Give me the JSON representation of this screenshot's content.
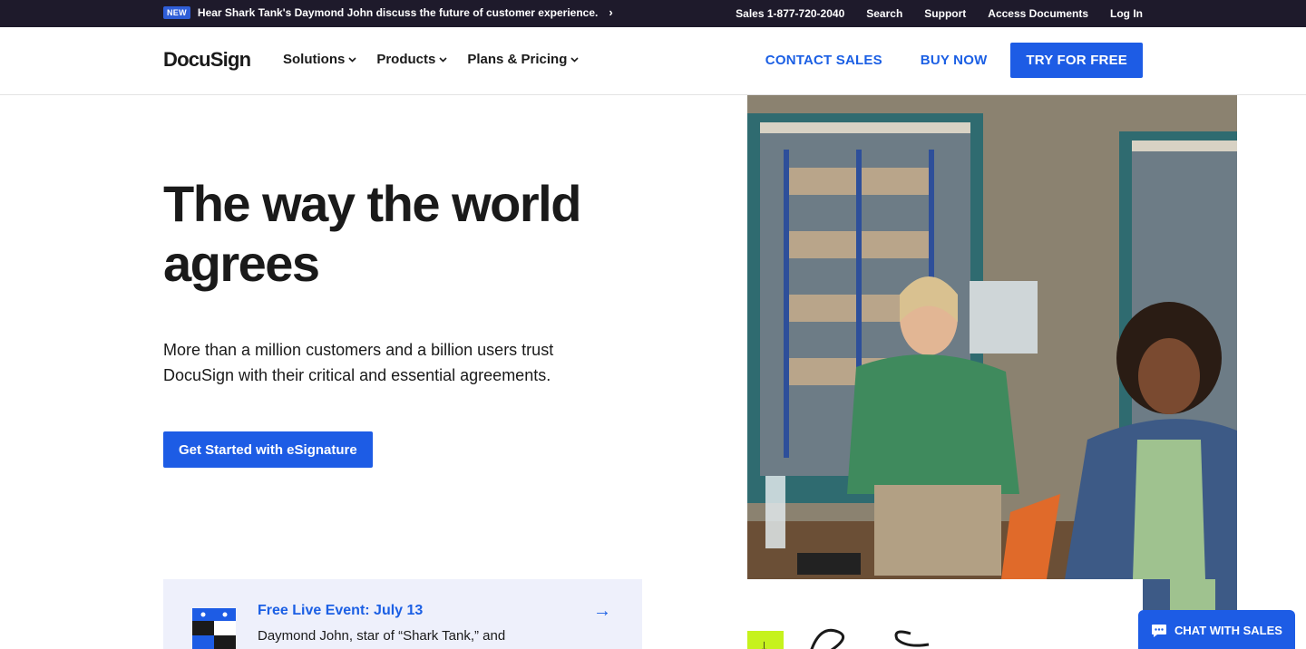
{
  "topbar": {
    "badge": "NEW",
    "promo": "Hear Shark Tank's Daymond John discuss the future of customer experience.",
    "chevron_icon": "›",
    "links": [
      "Sales 1-877-720-2040",
      "Search",
      "Support",
      "Access Documents",
      "Log In"
    ]
  },
  "header": {
    "logo": "DocuSign",
    "nav": [
      {
        "label": "Solutions"
      },
      {
        "label": "Products"
      },
      {
        "label": "Plans & Pricing"
      }
    ],
    "contact_sales": "CONTACT SALES",
    "buy_now": "BUY NOW",
    "try_free": "TRY FOR FREE"
  },
  "hero": {
    "title": "The way the world agrees",
    "subtitle": "More than a million customers and a billion users trust DocuSign with their critical and essential agreements.",
    "cta": "Get Started with eSignature"
  },
  "event": {
    "title": "Free Live Event: July 13",
    "description": "Daymond John, star of “Shark Tank,” and",
    "arrow_icon": "→"
  },
  "chat": {
    "label": "CHAT WITH SALES"
  },
  "colors": {
    "brand_blue": "#1d5ce5",
    "topbar_bg": "#1e1a2b",
    "event_bg": "#eef0fb",
    "accent_green": "#c6f21d"
  }
}
